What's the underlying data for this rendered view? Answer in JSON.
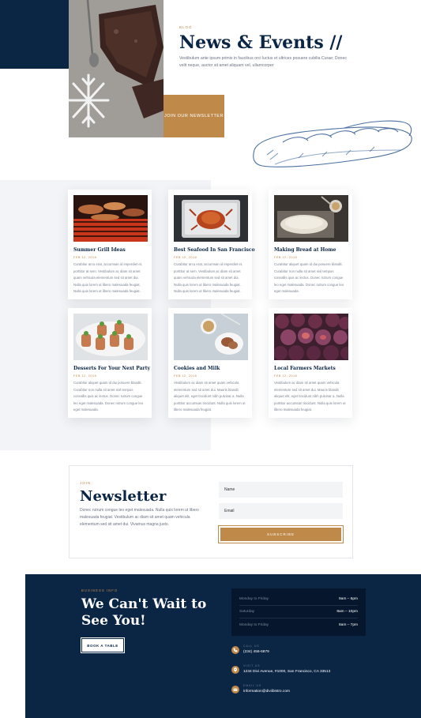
{
  "hero": {
    "label": "Blog",
    "title": "News & Events //",
    "description": "Vestibulum ante ipsum primis in faucibus orci luctus et ultrices posuere cubilia Curae; Donec velit neque, auctor sit amet aliquam vel, ullamcorper",
    "newsletter_button": "Join our newsletter"
  },
  "posts": [
    {
      "title": "Summer Grill Ideas",
      "date": "FEB 12, 2018",
      "excerpt": "Curabitur arcu erat, accumsan id imperdiet et, porttitor at sem. Vestibulum ac diam sit amet quam vehicula elementum sed sit amet dui. Nulla quis lorem ut libero malesuada feugiat. Nulla quis lorem ut libero malesuada feugiat."
    },
    {
      "title": "Best Seafood In San Francisco",
      "date": "FEB 12, 2018",
      "excerpt": "Curabitur arcu erat, accumsan id imperdiet et, porttitor at sem. Vestibulum ac diam sit amet quam vehicula elementum sed sit amet dui. Nulla quis lorem ut libero malesuada feugiat. Nulla quis lorem ut libero malesuada feugiat."
    },
    {
      "title": "Making Bread at Home",
      "date": "FEB 12, 2018",
      "excerpt": "Curabitur aliquet quam id dui posuere blandit. Curabitur non nulla sit amet nisl tempus convallis quis ac lectus. Donec rutrum congue leo eget malesuada. Donec rutrum congue leo eget malesuada."
    },
    {
      "title": "Desserts For Your Next Party",
      "date": "FEB 12, 2018",
      "excerpt": "Curabitur aliquet quam id dui posuere blandit. Curabitur non nulla sit amet nisl tempus convallis quis ac lectus. Donec rutrum congue leo eget malesuada. Donec rutrum congue leo eget malesuada."
    },
    {
      "title": "Cookies and Milk",
      "date": "FEB 12, 2018",
      "excerpt": "Vestibulum ac diam sit amet quam vehicula elementum sed sit amet dui. Mauris blandit aliquet elit, eget tincidunt nibh pulvinar a. Nulla porttitor accumsan tincidunt. Nulla quis lorem ut libero malesuada feugiat."
    },
    {
      "title": "Local Farmers Markets",
      "date": "FEB 12, 2018",
      "excerpt": "Vestibulum ac diam sit amet quam vehicula elementum sed sit amet dui. Mauris blandit aliquet elit, eget tincidunt nibh pulvinar a. Nulla porttitor accumsan tincidunt. Nulla quis lorem ut libero malesuada feugiat."
    }
  ],
  "newsletter": {
    "label": "Join",
    "title": "Newsletter",
    "description": "Donec rutrum congue leo eget malesuada. Nulla quis lorem ut libero malesuada feugiat. Vestibulum ac diam sit amet quam vehicula elementum sed sit amet dui. Vivamus magna justo.",
    "name_placeholder": "Name",
    "email_placeholder": "Email",
    "submit_label": "Subscribe"
  },
  "footer": {
    "label": "Business Info",
    "title": "We Can't Wait to See You!",
    "book_button": "Book a Table",
    "hours": [
      {
        "day": "Monday to Friday",
        "time": "9am – 6pm"
      },
      {
        "day": "Saturday",
        "time": "8am – 10pm"
      },
      {
        "day": "Monday to Friday",
        "time": "8am – 7pm"
      }
    ],
    "contact": [
      {
        "label": "Call Us",
        "value": "(234) 456-6879",
        "icon": "phone-icon"
      },
      {
        "label": "Visit Us",
        "value": "1234 Divi Avenue, #1000, San Francisco, CA 33513",
        "icon": "location-pin-icon"
      },
      {
        "label": "Email Us",
        "value": "information@diviibistro.com",
        "icon": "mail-icon"
      }
    ]
  },
  "colors": {
    "navy": "#0b2545",
    "gold": "#bf8949",
    "light_bg": "#f3f4f7"
  }
}
